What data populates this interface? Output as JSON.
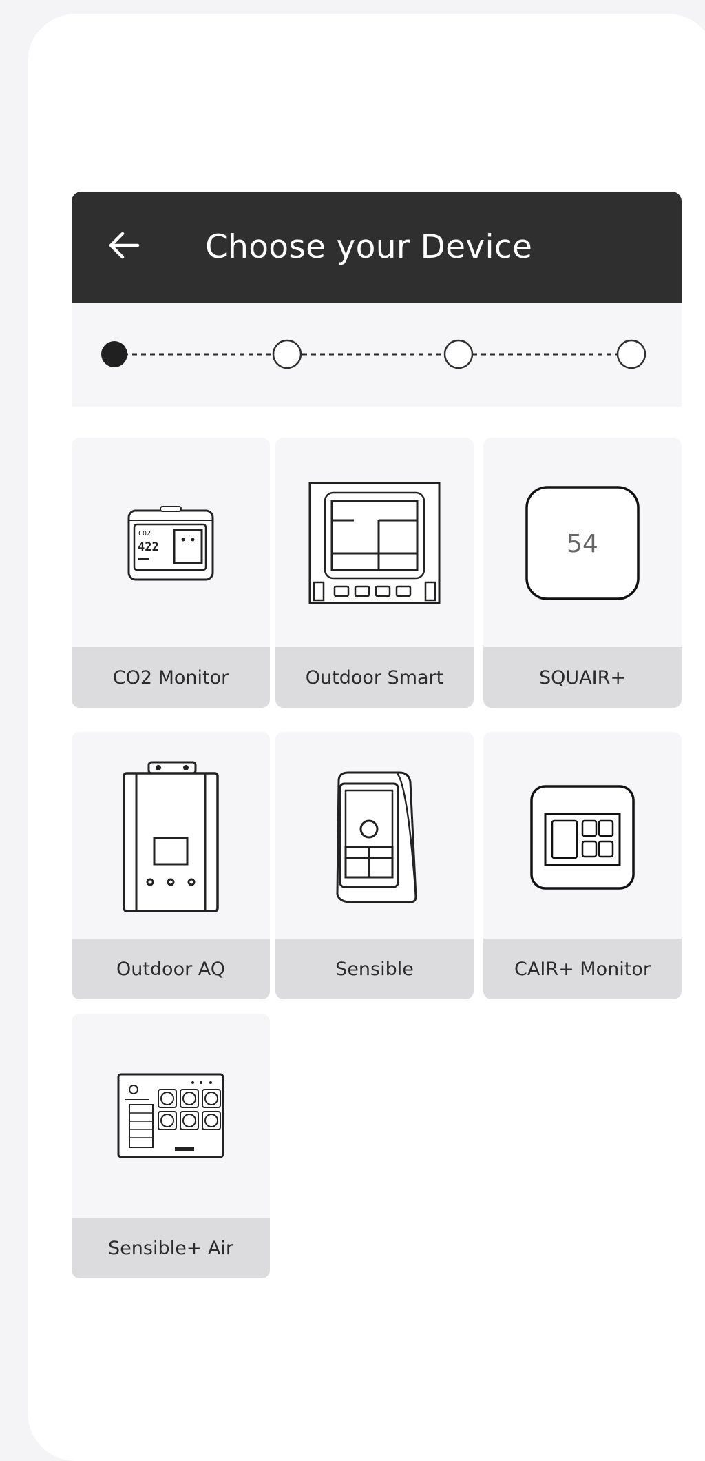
{
  "header": {
    "title": "Choose your Device",
    "back_icon": "arrow-left-icon"
  },
  "stepper": {
    "total_steps": 4,
    "current_step": 1
  },
  "devices": [
    {
      "label": "CO2 Monitor",
      "icon": "co2-monitor-icon",
      "screen_reading": "422",
      "screen_unit": "CO2"
    },
    {
      "label": "Outdoor Smart",
      "icon": "outdoor-smart-icon"
    },
    {
      "label": "SQUAIR+",
      "icon": "squair-icon",
      "display_value": "54"
    },
    {
      "label": "Outdoor AQ",
      "icon": "outdoor-aq-icon"
    },
    {
      "label": "Sensible",
      "icon": "sensible-icon"
    },
    {
      "label": "CAIR+ Monitor",
      "icon": "cair-monitor-icon"
    },
    {
      "label": "Sensible+ Air",
      "icon": "sensible-plus-air-icon"
    }
  ],
  "colors": {
    "header": "#2f2f2f",
    "card": "#f6f6f9",
    "label_bar": "#dcdcde",
    "active_step": "#202020"
  }
}
